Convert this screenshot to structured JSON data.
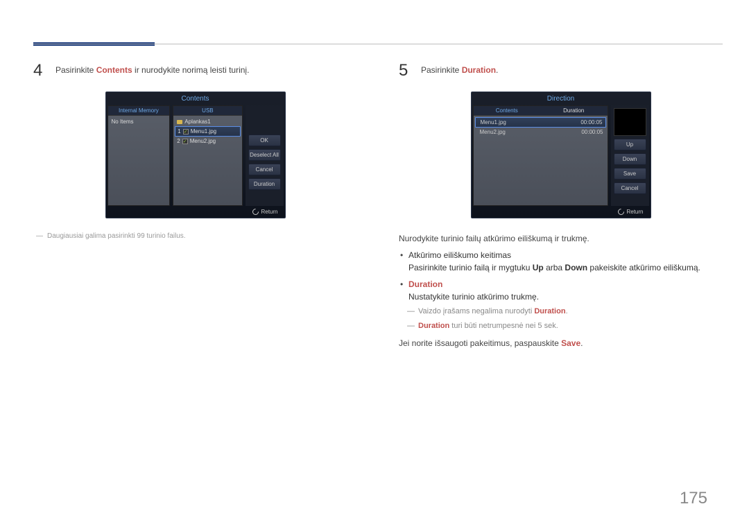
{
  "page_number": "175",
  "left": {
    "step_num": "4",
    "step_text_pre": "Pasirinkite ",
    "step_text_em": "Contents",
    "step_text_post": " ir nurodykite norimą leisti turinį.",
    "screen": {
      "title": "Contents",
      "left_tab": "Internal Memory",
      "left_empty": "No Items",
      "right_tab": "USB",
      "folder": "Aplankas1",
      "row1_idx": "1",
      "row1_name": "Menu1.jpg",
      "row2_idx": "2",
      "row2_name": "Menu2.jpg",
      "btn_ok": "OK",
      "btn_deselect": "Deselect All",
      "btn_cancel": "Cancel",
      "btn_duration": "Duration",
      "return": "Return"
    },
    "note": "Daugiausiai galima pasirinkti 99 turinio failus."
  },
  "right": {
    "step_num": "5",
    "step_text_pre": "Pasirinkite ",
    "step_text_em": "Duration",
    "step_text_post": ".",
    "screen": {
      "title": "Direction",
      "left_tab": "Contents",
      "right_tab": "Duration",
      "row1_name": "Menu1.jpg",
      "row1_dur": "00:00:05",
      "row2_name": "Menu2.jpg",
      "row2_dur": "00:00:05",
      "btn_up": "Up",
      "btn_down": "Down",
      "btn_save": "Save",
      "btn_cancel": "Cancel",
      "return": "Return"
    },
    "p1": "Nurodykite turinio failų atkūrimo eiliškumą ir trukmę.",
    "b1_title": "Atkūrimo eiliškumo keitimas",
    "b1_line_pre": "Pasirinkite turinio failą ir mygtuku ",
    "b1_up": "Up",
    "b1_mid": " arba ",
    "b1_down": "Down",
    "b1_post": " pakeiskite atkūrimo eiliškumą.",
    "b2_title": "Duration",
    "b2_line": "Nustatykite turinio atkūrimo trukmę.",
    "b2_sub1_pre": "Vaizdo įrašams negalima nurodyti ",
    "b2_sub1_em": "Duration",
    "b2_sub1_post": ".",
    "b2_sub2_em": "Duration",
    "b2_sub2_post": " turi būti netrumpesnė nei 5 sek.",
    "p2_pre": "Jei norite išsaugoti pakeitimus, paspauskite ",
    "p2_em": "Save",
    "p2_post": "."
  }
}
